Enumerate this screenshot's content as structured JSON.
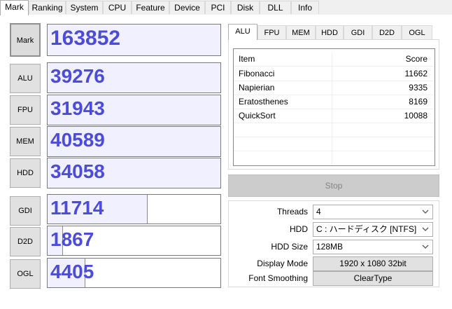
{
  "tabs": [
    "Mark",
    "Ranking",
    "System",
    "CPU",
    "Feature",
    "Device",
    "PCI",
    "Disk",
    "DLL",
    "Info"
  ],
  "left": {
    "main": {
      "label": "Mark",
      "score": "163852"
    },
    "items": [
      {
        "label": "ALU",
        "score": "39276",
        "fill": 1.0
      },
      {
        "label": "FPU",
        "score": "31943",
        "fill": 1.0
      },
      {
        "label": "MEM",
        "score": "40589",
        "fill": 1.0
      },
      {
        "label": "HDD",
        "score": "34058",
        "fill": 1.0
      },
      {
        "label": "GDI",
        "score": "11714",
        "fill": 0.58
      },
      {
        "label": "D2D",
        "score": "1867",
        "fill": 0.09
      },
      {
        "label": "OGL",
        "score": "4405",
        "fill": 0.22
      }
    ]
  },
  "right": {
    "tabs": [
      "ALU",
      "FPU",
      "MEM",
      "HDD",
      "GDI",
      "D2D",
      "OGL"
    ],
    "list": {
      "headers": [
        "Item",
        "Score"
      ],
      "rows": [
        [
          "Fibonacci",
          "11662"
        ],
        [
          "Napierian",
          "9335"
        ],
        [
          "Eratosthenes",
          "8169"
        ],
        [
          "QuickSort",
          "10088"
        ]
      ]
    },
    "stop_label": "Stop"
  },
  "settings": {
    "threads": {
      "label": "Threads",
      "value": "4"
    },
    "hdd": {
      "label": "HDD",
      "value": "C : ハードディスク [NTFS]"
    },
    "hdd_size": {
      "label": "HDD Size",
      "value": "128MB"
    },
    "display_mode": {
      "label": "Display Mode",
      "value": "1920 x 1080 32bit"
    },
    "font_smoothing": {
      "label": "Font Smoothing",
      "value": "ClearType"
    }
  },
  "icons": {
    "dropdown": "chevron-down-icon"
  },
  "colors": {
    "score_text": "#4c4cd8",
    "bar_fill": "#f0f0ff",
    "stop_bg": "#cccccc"
  }
}
